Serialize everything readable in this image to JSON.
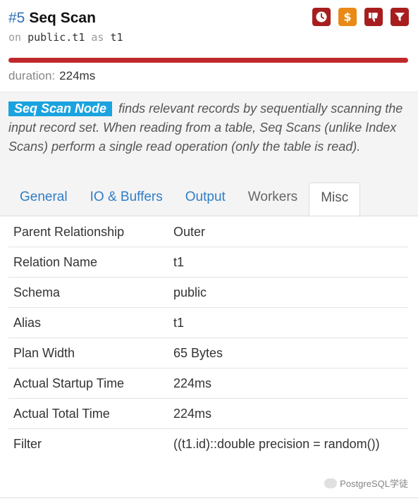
{
  "node": {
    "number": "#5",
    "name": "Seq Scan",
    "on_keyword": "on",
    "relation": "public.t1",
    "as_keyword": "as",
    "alias": "t1",
    "duration_label": "duration:",
    "duration_value": "224ms",
    "duration_bar_fraction": 1.0,
    "bar_color": "#c0282b"
  },
  "badges": [
    {
      "name": "clock-icon",
      "color": "#a81e1e"
    },
    {
      "name": "dollar-icon",
      "color": "#e98a17"
    },
    {
      "name": "thumbs-down-icon",
      "color": "#a81e1e"
    },
    {
      "name": "filter-icon",
      "color": "#a81e1e"
    }
  ],
  "description": {
    "tag": "Seq Scan Node",
    "text": "finds relevant records by sequentially scanning the input record set. When reading from a table, Seq Scans (unlike Index Scans) perform a single read operation (only the table is read)."
  },
  "tabs": [
    {
      "label": "General",
      "active": false
    },
    {
      "label": "IO & Buffers",
      "active": false
    },
    {
      "label": "Output",
      "active": false
    },
    {
      "label": "Workers",
      "active": false
    },
    {
      "label": "Misc",
      "active": true
    }
  ],
  "misc_rows": [
    {
      "key": "Parent Relationship",
      "value": "Outer"
    },
    {
      "key": "Relation Name",
      "value": "t1"
    },
    {
      "key": "Schema",
      "value": "public"
    },
    {
      "key": "Alias",
      "value": "t1"
    },
    {
      "key": "Plan Width",
      "value": "65 Bytes"
    },
    {
      "key": "Actual Startup Time",
      "value": "224ms"
    },
    {
      "key": "Actual Total Time",
      "value": "224ms"
    },
    {
      "key": "Filter",
      "value": "((t1.id)::double precision = random())"
    }
  ],
  "watermark": {
    "text": "PostgreSQL学徒"
  }
}
